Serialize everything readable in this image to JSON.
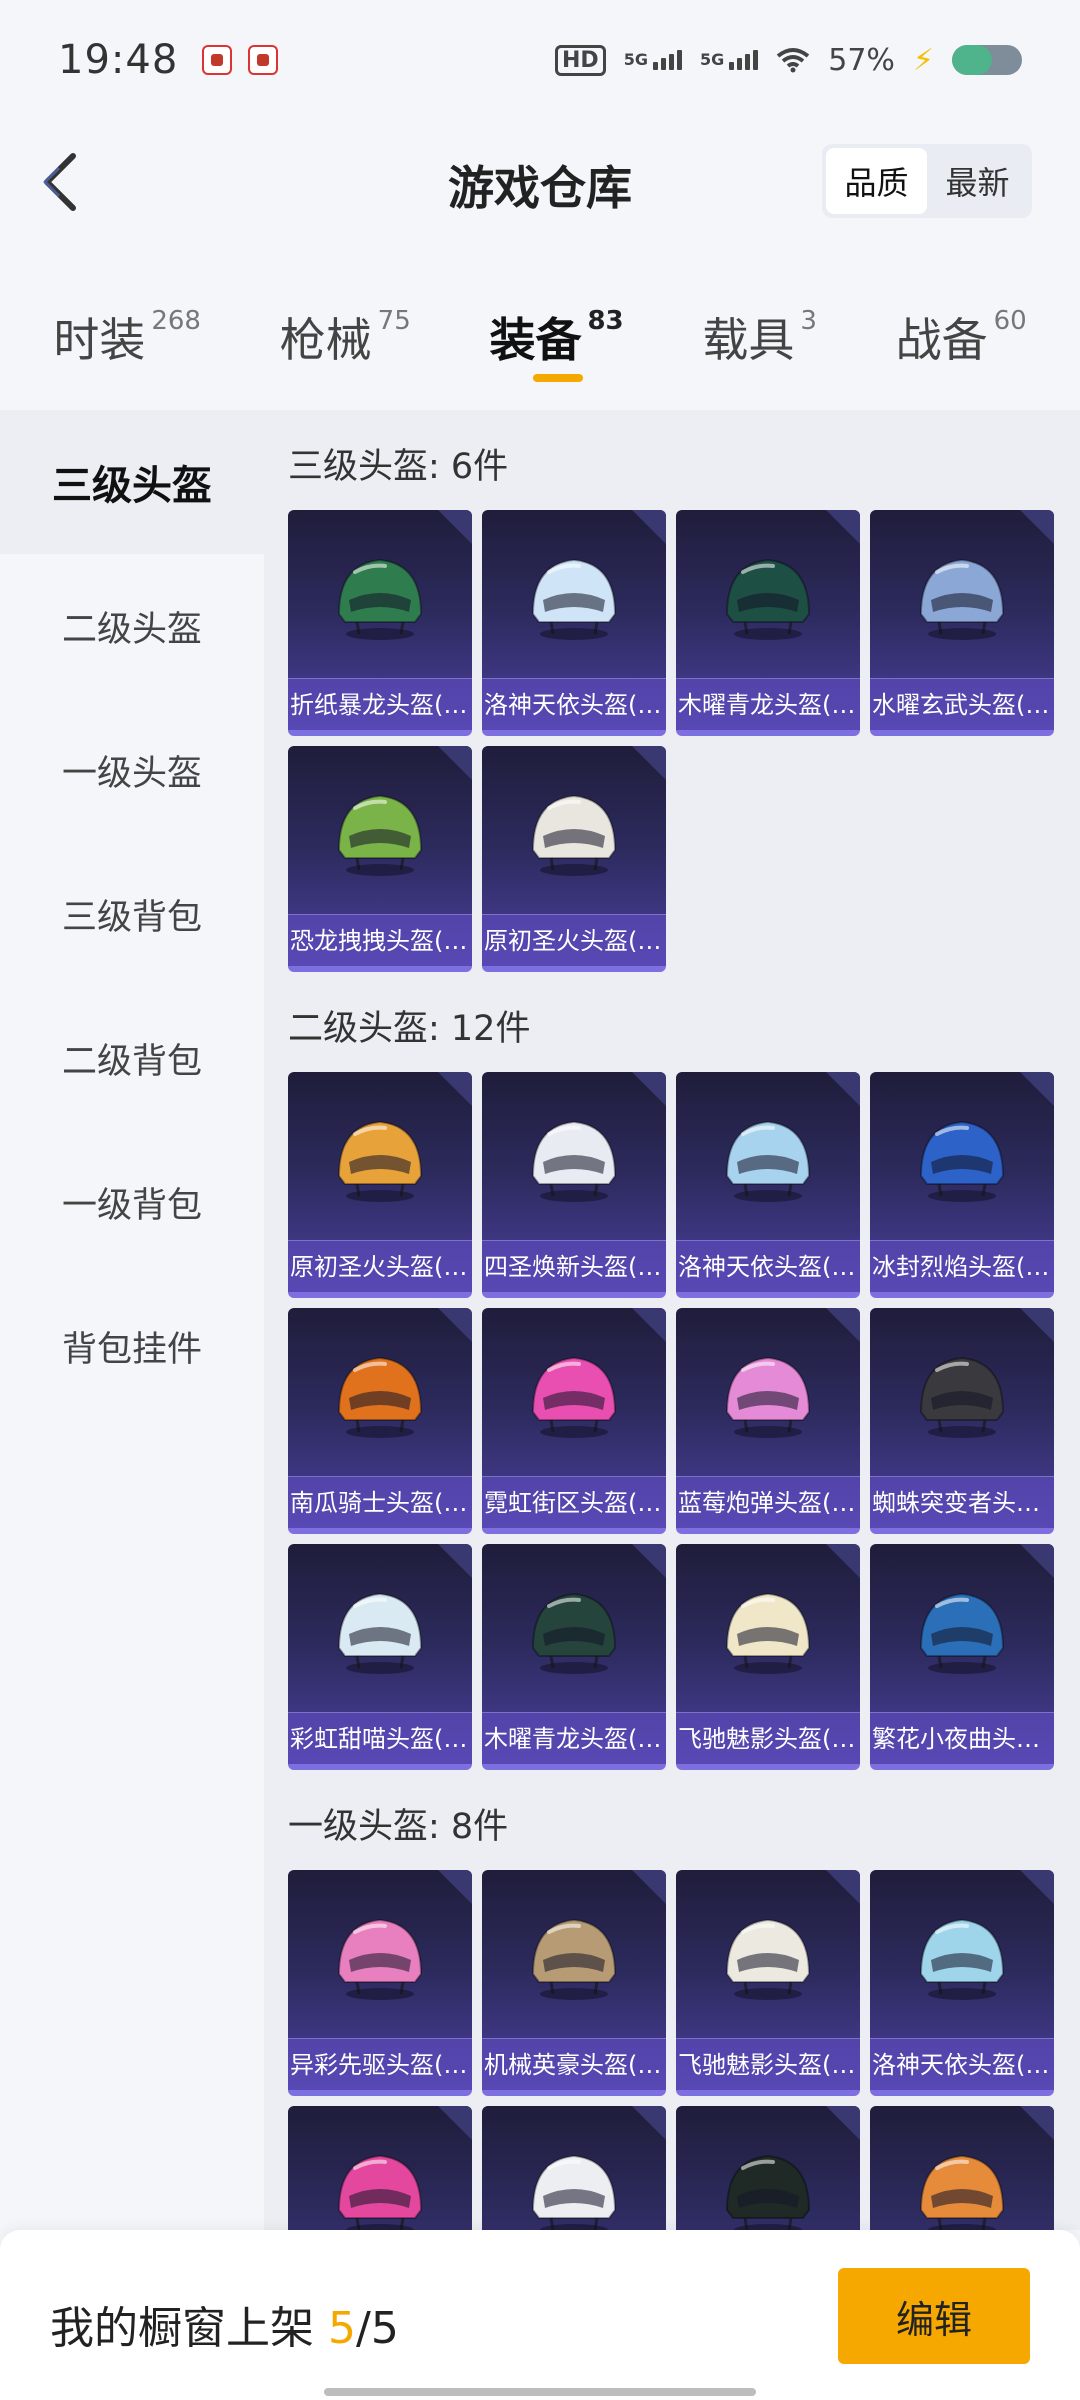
{
  "status_bar": {
    "time": "19:48",
    "hd_label": "HD",
    "signal1_label": "5G",
    "signal2_label": "5G",
    "battery_text": "57%",
    "battery_level": 0.57
  },
  "header": {
    "title": "游戏仓库",
    "sort_options": [
      "品质",
      "最新"
    ],
    "active_sort": 0
  },
  "tabs": [
    {
      "label": "时装",
      "count": "268"
    },
    {
      "label": "枪械",
      "count": "75"
    },
    {
      "label": "装备",
      "count": "83",
      "active": true
    },
    {
      "label": "载具",
      "count": "3"
    },
    {
      "label": "战备",
      "count": "60"
    }
  ],
  "sidebar": {
    "items": [
      "三级头盔",
      "二级头盔",
      "一级头盔",
      "三级背包",
      "二级背包",
      "一级背包",
      "背包挂件"
    ],
    "active": 0
  },
  "sections": [
    {
      "title": "三级头盔: 6件",
      "items": [
        {
          "name": "折纸暴龙头盔(…",
          "color": "#2f7d4f",
          "icon": "dragon-helmet-icon"
        },
        {
          "name": "洛神天依头盔(…",
          "color": "#cfe4f7",
          "icon": "visor-helmet-icon"
        },
        {
          "name": "木曜青龙头盔(…",
          "color": "#1e4f45",
          "icon": "dragon-helmet-icon"
        },
        {
          "name": "水曜玄武头盔(…",
          "color": "#8aa7d6",
          "icon": "armor-helmet-icon"
        },
        {
          "name": "恐龙拽拽头盔(…",
          "color": "#7ab347",
          "icon": "dino-helmet-icon"
        },
        {
          "name": "原初圣火头盔(…",
          "color": "#e9e6df",
          "icon": "visor-helmet-icon"
        }
      ]
    },
    {
      "title": "二级头盔: 12件",
      "items": [
        {
          "name": "原初圣火头盔(…",
          "color": "#e8a23a",
          "icon": "helmet-icon"
        },
        {
          "name": "四圣焕新头盔(…",
          "color": "#e8ecf2",
          "icon": "helmet-icon"
        },
        {
          "name": "洛神天依头盔(…",
          "color": "#a8d3ee",
          "icon": "helmet-icon"
        },
        {
          "name": "冰封烈焰头盔(…",
          "color": "#2d62c8",
          "icon": "helmet-icon"
        },
        {
          "name": "南瓜骑士头盔(…",
          "color": "#e0721e",
          "icon": "helmet-icon"
        },
        {
          "name": "霓虹街区头盔(…",
          "color": "#e84fb0",
          "icon": "helmet-icon"
        },
        {
          "name": "蓝莓炮弹头盔(…",
          "color": "#e58ad6",
          "icon": "helmet-icon"
        },
        {
          "name": "蜘蛛突变者头…",
          "color": "#3a3a3e",
          "icon": "helmet-icon"
        },
        {
          "name": "彩虹甜喵头盔(…",
          "color": "#d9eaf2",
          "icon": "helmet-icon"
        },
        {
          "name": "木曜青龙头盔(…",
          "color": "#25453c",
          "icon": "helmet-icon"
        },
        {
          "name": "飞驰魅影头盔(…",
          "color": "#f0e6c8",
          "icon": "helmet-icon"
        },
        {
          "name": "繁花小夜曲头…",
          "color": "#2a6fb8",
          "icon": "helmet-icon"
        }
      ]
    },
    {
      "title": "一级头盔: 8件",
      "items": [
        {
          "name": "异彩先驱头盔(…",
          "color": "#e87fbf",
          "icon": "helmet-icon"
        },
        {
          "name": "机械英豪头盔(…",
          "color": "#b79b74",
          "icon": "helmet-icon"
        },
        {
          "name": "飞驰魅影头盔(…",
          "color": "#ece9e0",
          "icon": "helmet-icon"
        },
        {
          "name": "洛神天依头盔(…",
          "color": "#9fd5ea",
          "icon": "helmet-icon"
        },
        {
          "name": "",
          "color": "#e3489e",
          "icon": "helmet-icon"
        },
        {
          "name": "",
          "color": "#eceef2",
          "icon": "helmet-icon"
        },
        {
          "name": "",
          "color": "#1f2a26",
          "icon": "helmet-icon"
        },
        {
          "name": "",
          "color": "#e58b3a",
          "icon": "helmet-icon"
        }
      ]
    }
  ],
  "footer": {
    "showcase_label": "我的橱窗上架",
    "showcase_current": "5",
    "showcase_total": "/5",
    "edit_label": "编辑"
  }
}
